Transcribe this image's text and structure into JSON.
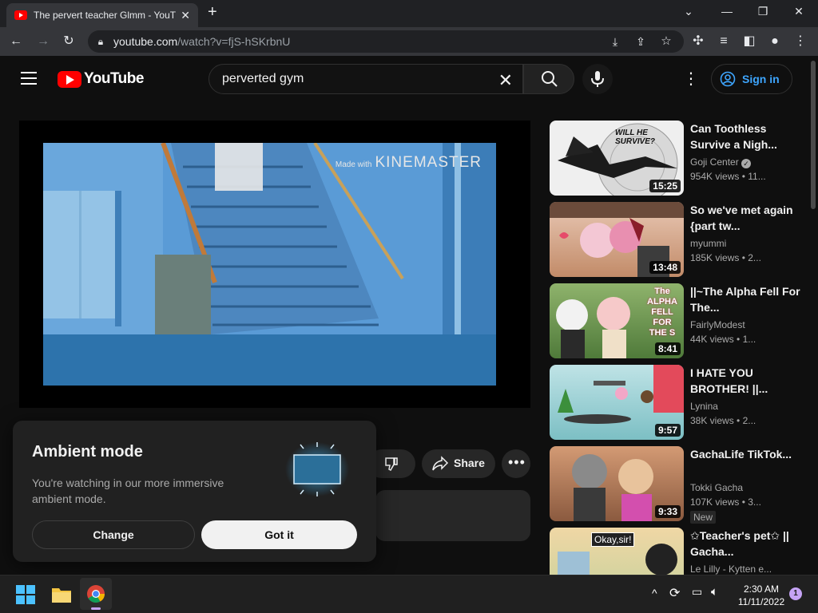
{
  "browser": {
    "tab_title": "The pervert teacher Glmm - YouTube",
    "url_host": "youtube.com",
    "url_path": "/watch?v=fjS-hSKrbnU"
  },
  "youtube": {
    "logo_text": "YouTube",
    "search_value": "perverted gym",
    "sign_in_label": "Sign in"
  },
  "player": {
    "watermark_prefix": "Made with",
    "watermark_brand": "KINEMASTER"
  },
  "actions": {
    "share_label": "Share"
  },
  "ambient": {
    "title": "Ambient mode",
    "body": "You're watching in our more immersive ambient mode.",
    "change_label": "Change",
    "got_it_label": "Got it"
  },
  "recommendations": [
    {
      "title": "Can Toothless Survive a Nigh...",
      "channel": "Goji Center",
      "views": "954K views",
      "age": "11...",
      "duration": "15:25",
      "verified": true
    },
    {
      "title": "So we've met again {part tw...",
      "channel": "myummi",
      "views": "185K views",
      "age": "2...",
      "duration": "13:48"
    },
    {
      "title": "||~The Alpha Fell For The...",
      "channel": "FairlyModest",
      "views": "44K views",
      "age": "1...",
      "duration": "8:41"
    },
    {
      "title": "I HATE YOU BROTHER! ||...",
      "channel": "Lynina",
      "views": "38K views",
      "age": "2...",
      "duration": "9:57"
    },
    {
      "title": "GachaLife TikTok...",
      "channel": "Tokki Gacha",
      "views": "107K views",
      "age": "3...",
      "duration": "9:33",
      "badge": "New"
    },
    {
      "title": "✩Teacher's pet✩ || Gacha...",
      "channel": "Le Lilly - Kytten e...",
      "views": "",
      "age": "",
      "duration": ""
    }
  ],
  "thumb_texts": {
    "survive": "WILL HE SURVIVE?",
    "alpha": "The ALPHA FELL FOR THE S",
    "okay": "Okay,sir!"
  },
  "taskbar": {
    "time": "2:30 AM",
    "date": "11/11/2022",
    "notification_count": "1"
  }
}
